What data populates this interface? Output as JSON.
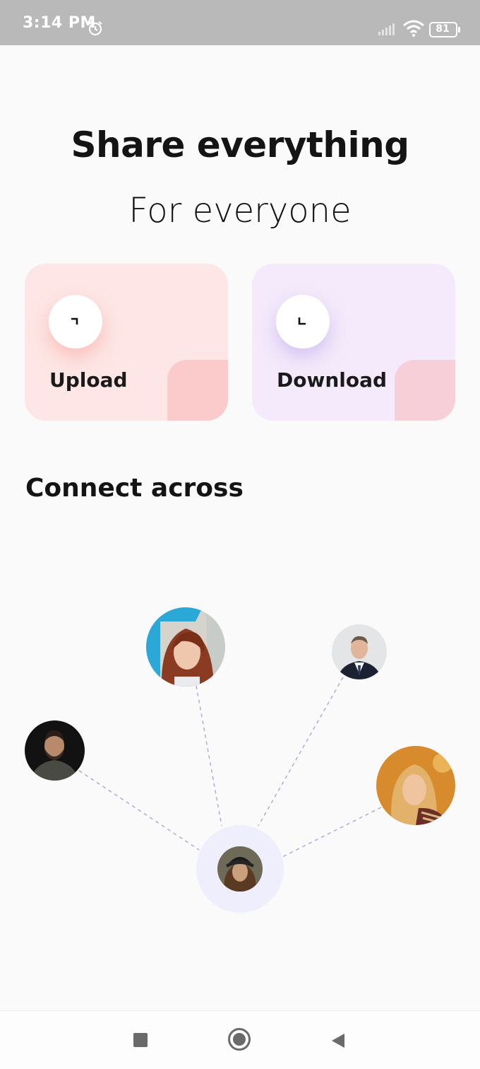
{
  "status_bar": {
    "time": "3:14 PM",
    "battery": "81",
    "icons": [
      "alarm-icon",
      "signal-icon",
      "wifi-icon",
      "battery-icon"
    ]
  },
  "header": {
    "title": "Share everything",
    "subtitle": "For everyone"
  },
  "cards": [
    {
      "label": "Upload",
      "icon": "upload-icon",
      "color": "#fde6e5",
      "accent": "#fbcaca"
    },
    {
      "label": "Download",
      "icon": "download-icon",
      "color": "#f4eafb",
      "accent": "#f6cfd9"
    }
  ],
  "connect": {
    "heading": "Connect across",
    "contacts": [
      "contact-avatar-woman-redhair",
      "contact-avatar-man-suit",
      "contact-avatar-man-beard",
      "contact-avatar-woman-blonde"
    ],
    "center": "user-avatar-center"
  },
  "nav_bar": {
    "buttons": [
      "recents-button",
      "home-button",
      "back-button"
    ]
  }
}
